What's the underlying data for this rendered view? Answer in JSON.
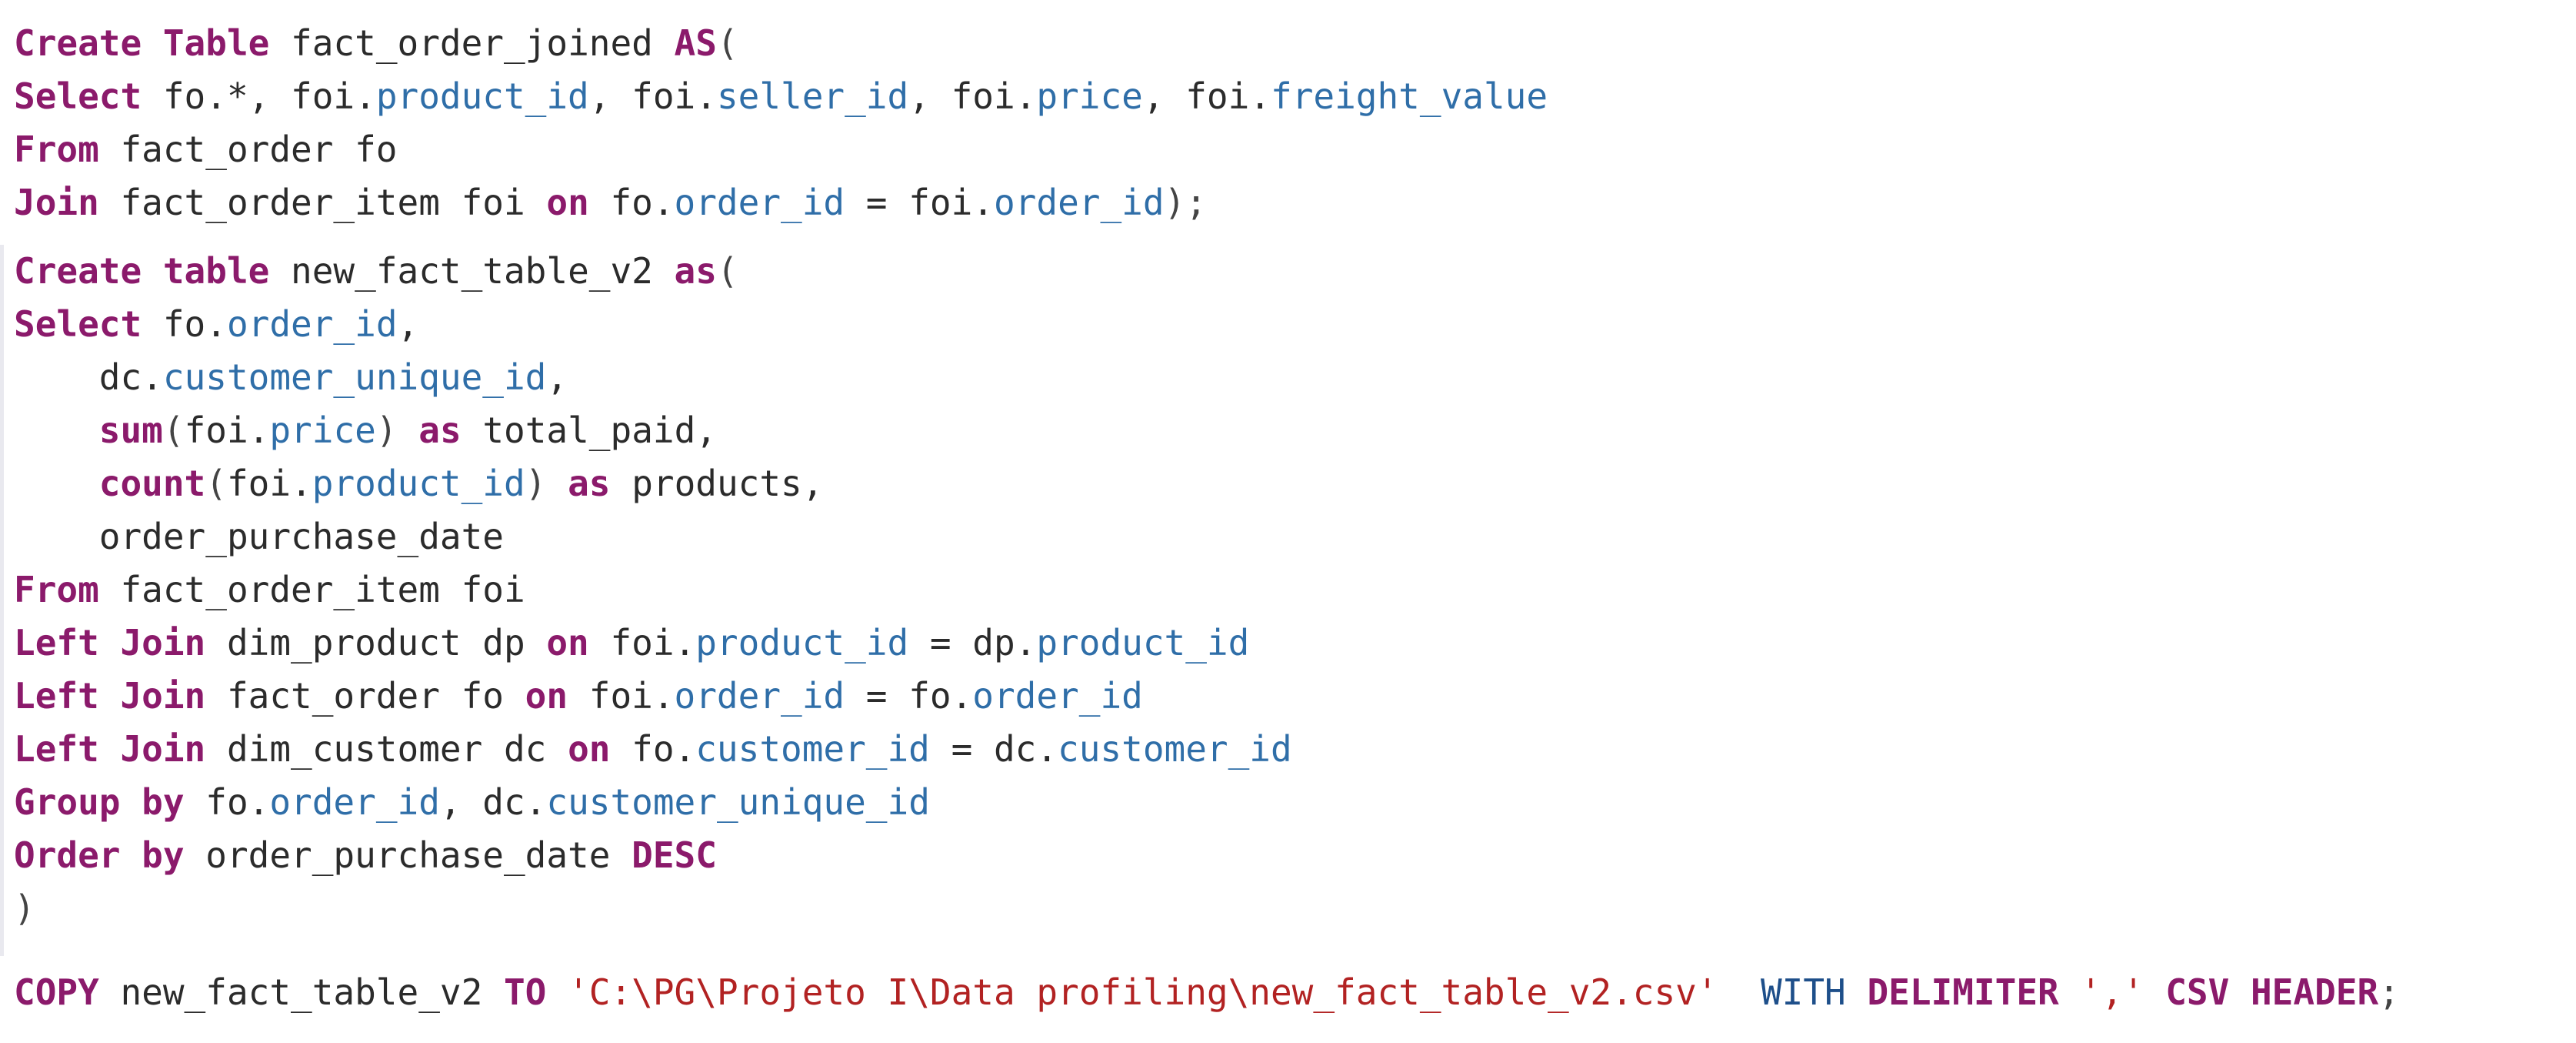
{
  "editor": {
    "language": "sql",
    "lines": [
      [
        {
          "t": "kw",
          "v": "Create Table"
        },
        {
          "t": "id",
          "v": " fact_order_joined "
        },
        {
          "t": "kw",
          "v": "AS"
        },
        {
          "t": "punct",
          "v": "("
        }
      ],
      [
        {
          "t": "kw",
          "v": "Select"
        },
        {
          "t": "id",
          "v": " fo.*, foi."
        },
        {
          "t": "col",
          "v": "product_id"
        },
        {
          "t": "id",
          "v": ", foi."
        },
        {
          "t": "col",
          "v": "seller_id"
        },
        {
          "t": "id",
          "v": ", foi."
        },
        {
          "t": "col",
          "v": "price"
        },
        {
          "t": "id",
          "v": ", foi."
        },
        {
          "t": "col",
          "v": "freight_value"
        }
      ],
      [
        {
          "t": "kw",
          "v": "From"
        },
        {
          "t": "id",
          "v": " fact_order fo"
        }
      ],
      [
        {
          "t": "kw",
          "v": "Join"
        },
        {
          "t": "id",
          "v": " fact_order_item foi "
        },
        {
          "t": "kw",
          "v": "on"
        },
        {
          "t": "id",
          "v": " fo."
        },
        {
          "t": "col",
          "v": "order_id"
        },
        {
          "t": "id",
          "v": " = foi."
        },
        {
          "t": "col",
          "v": "order_id"
        },
        {
          "t": "punct",
          "v": ");"
        }
      ],
      [
        {
          "t": "kw",
          "v": "Create table"
        },
        {
          "t": "id",
          "v": " new_fact_table_v2 "
        },
        {
          "t": "kw",
          "v": "as"
        },
        {
          "t": "punct",
          "v": "("
        }
      ],
      [
        {
          "t": "kw",
          "v": "Select"
        },
        {
          "t": "id",
          "v": " fo."
        },
        {
          "t": "col",
          "v": "order_id"
        },
        {
          "t": "id",
          "v": ","
        }
      ],
      [
        {
          "t": "id",
          "v": "    dc."
        },
        {
          "t": "col",
          "v": "customer_unique_id"
        },
        {
          "t": "id",
          "v": ","
        }
      ],
      [
        {
          "t": "id",
          "v": "    "
        },
        {
          "t": "kw",
          "v": "sum"
        },
        {
          "t": "punct",
          "v": "("
        },
        {
          "t": "id",
          "v": "foi."
        },
        {
          "t": "col",
          "v": "price"
        },
        {
          "t": "punct",
          "v": ")"
        },
        {
          "t": "id",
          "v": " "
        },
        {
          "t": "kw",
          "v": "as"
        },
        {
          "t": "id",
          "v": " total_paid,"
        }
      ],
      [
        {
          "t": "id",
          "v": "    "
        },
        {
          "t": "kw",
          "v": "count"
        },
        {
          "t": "punct",
          "v": "("
        },
        {
          "t": "id",
          "v": "foi."
        },
        {
          "t": "col",
          "v": "product_id"
        },
        {
          "t": "punct",
          "v": ")"
        },
        {
          "t": "id",
          "v": " "
        },
        {
          "t": "kw",
          "v": "as"
        },
        {
          "t": "id",
          "v": " products,"
        }
      ],
      [
        {
          "t": "id",
          "v": "    order_purchase_date"
        }
      ],
      [
        {
          "t": "kw",
          "v": "From"
        },
        {
          "t": "id",
          "v": " fact_order_item foi"
        }
      ],
      [
        {
          "t": "kw",
          "v": "Left Join"
        },
        {
          "t": "id",
          "v": " dim_product dp "
        },
        {
          "t": "kw",
          "v": "on"
        },
        {
          "t": "id",
          "v": " foi."
        },
        {
          "t": "col",
          "v": "product_id"
        },
        {
          "t": "id",
          "v": " = dp."
        },
        {
          "t": "col",
          "v": "product_id"
        }
      ],
      [
        {
          "t": "kw",
          "v": "Left Join"
        },
        {
          "t": "id",
          "v": " fact_order fo "
        },
        {
          "t": "kw",
          "v": "on"
        },
        {
          "t": "id",
          "v": " foi."
        },
        {
          "t": "col",
          "v": "order_id"
        },
        {
          "t": "id",
          "v": " = fo."
        },
        {
          "t": "col",
          "v": "order_id"
        }
      ],
      [
        {
          "t": "kw",
          "v": "Left Join"
        },
        {
          "t": "id",
          "v": " dim_customer dc "
        },
        {
          "t": "kw",
          "v": "on"
        },
        {
          "t": "id",
          "v": " fo."
        },
        {
          "t": "col",
          "v": "customer_id"
        },
        {
          "t": "id",
          "v": " = dc."
        },
        {
          "t": "col",
          "v": "customer_id"
        }
      ],
      [
        {
          "t": "kw",
          "v": "Group by"
        },
        {
          "t": "id",
          "v": " fo."
        },
        {
          "t": "col",
          "v": "order_id"
        },
        {
          "t": "id",
          "v": ", dc."
        },
        {
          "t": "col",
          "v": "customer_unique_id"
        }
      ],
      [
        {
          "t": "kw",
          "v": "Order by"
        },
        {
          "t": "id",
          "v": " order_purchase_date "
        },
        {
          "t": "kw",
          "v": "DESC"
        }
      ],
      [
        {
          "t": "punct",
          "v": ")"
        }
      ],
      [
        {
          "t": "kw",
          "v": "COPY"
        },
        {
          "t": "id",
          "v": " new_fact_table_v2 "
        },
        {
          "t": "kw",
          "v": "TO"
        },
        {
          "t": "id",
          "v": " "
        },
        {
          "t": "str",
          "v": "'C:\\PG\\Projeto I\\Data profiling\\new_fact_table_v2.csv'"
        },
        {
          "t": "id",
          "v": "  "
        },
        {
          "t": "sys",
          "v": "WITH"
        },
        {
          "t": "id",
          "v": " "
        },
        {
          "t": "kw",
          "v": "DELIMITER"
        },
        {
          "t": "id",
          "v": " "
        },
        {
          "t": "str",
          "v": "','"
        },
        {
          "t": "id",
          "v": " "
        },
        {
          "t": "kw",
          "v": "CSV HEADER"
        },
        {
          "t": "punct",
          "v": ";"
        }
      ]
    ]
  }
}
